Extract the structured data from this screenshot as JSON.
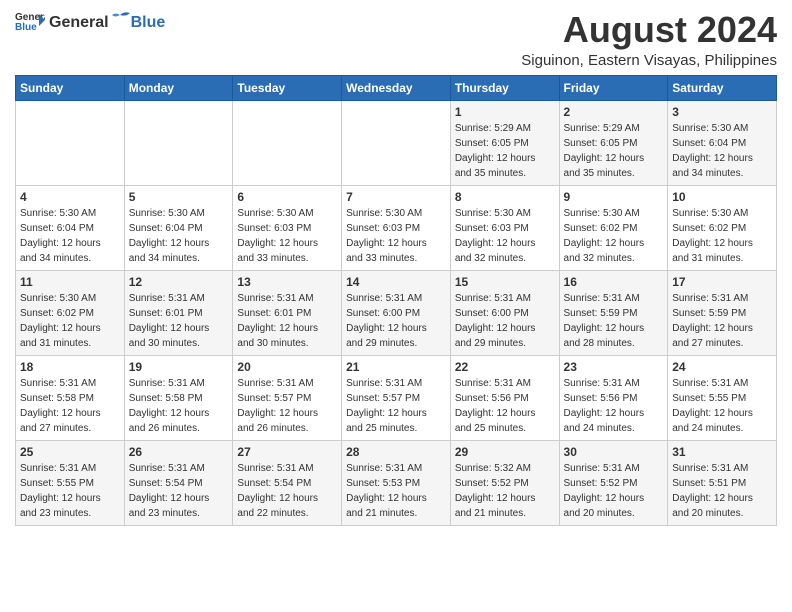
{
  "header": {
    "logo_general": "General",
    "logo_blue": "Blue",
    "month_year": "August 2024",
    "location": "Siguinon, Eastern Visayas, Philippines"
  },
  "days_of_week": [
    "Sunday",
    "Monday",
    "Tuesday",
    "Wednesday",
    "Thursday",
    "Friday",
    "Saturday"
  ],
  "weeks": [
    [
      {
        "day": "",
        "sunrise": "",
        "sunset": "",
        "daylight": ""
      },
      {
        "day": "",
        "sunrise": "",
        "sunset": "",
        "daylight": ""
      },
      {
        "day": "",
        "sunrise": "",
        "sunset": "",
        "daylight": ""
      },
      {
        "day": "",
        "sunrise": "",
        "sunset": "",
        "daylight": ""
      },
      {
        "day": "1",
        "sunrise": "5:29 AM",
        "sunset": "6:05 PM",
        "daylight": "12 hours and 35 minutes."
      },
      {
        "day": "2",
        "sunrise": "5:29 AM",
        "sunset": "6:05 PM",
        "daylight": "12 hours and 35 minutes."
      },
      {
        "day": "3",
        "sunrise": "5:30 AM",
        "sunset": "6:04 PM",
        "daylight": "12 hours and 34 minutes."
      }
    ],
    [
      {
        "day": "4",
        "sunrise": "5:30 AM",
        "sunset": "6:04 PM",
        "daylight": "12 hours and 34 minutes."
      },
      {
        "day": "5",
        "sunrise": "5:30 AM",
        "sunset": "6:04 PM",
        "daylight": "12 hours and 34 minutes."
      },
      {
        "day": "6",
        "sunrise": "5:30 AM",
        "sunset": "6:03 PM",
        "daylight": "12 hours and 33 minutes."
      },
      {
        "day": "7",
        "sunrise": "5:30 AM",
        "sunset": "6:03 PM",
        "daylight": "12 hours and 33 minutes."
      },
      {
        "day": "8",
        "sunrise": "5:30 AM",
        "sunset": "6:03 PM",
        "daylight": "12 hours and 32 minutes."
      },
      {
        "day": "9",
        "sunrise": "5:30 AM",
        "sunset": "6:02 PM",
        "daylight": "12 hours and 32 minutes."
      },
      {
        "day": "10",
        "sunrise": "5:30 AM",
        "sunset": "6:02 PM",
        "daylight": "12 hours and 31 minutes."
      }
    ],
    [
      {
        "day": "11",
        "sunrise": "5:30 AM",
        "sunset": "6:02 PM",
        "daylight": "12 hours and 31 minutes."
      },
      {
        "day": "12",
        "sunrise": "5:31 AM",
        "sunset": "6:01 PM",
        "daylight": "12 hours and 30 minutes."
      },
      {
        "day": "13",
        "sunrise": "5:31 AM",
        "sunset": "6:01 PM",
        "daylight": "12 hours and 30 minutes."
      },
      {
        "day": "14",
        "sunrise": "5:31 AM",
        "sunset": "6:00 PM",
        "daylight": "12 hours and 29 minutes."
      },
      {
        "day": "15",
        "sunrise": "5:31 AM",
        "sunset": "6:00 PM",
        "daylight": "12 hours and 29 minutes."
      },
      {
        "day": "16",
        "sunrise": "5:31 AM",
        "sunset": "5:59 PM",
        "daylight": "12 hours and 28 minutes."
      },
      {
        "day": "17",
        "sunrise": "5:31 AM",
        "sunset": "5:59 PM",
        "daylight": "12 hours and 27 minutes."
      }
    ],
    [
      {
        "day": "18",
        "sunrise": "5:31 AM",
        "sunset": "5:58 PM",
        "daylight": "12 hours and 27 minutes."
      },
      {
        "day": "19",
        "sunrise": "5:31 AM",
        "sunset": "5:58 PM",
        "daylight": "12 hours and 26 minutes."
      },
      {
        "day": "20",
        "sunrise": "5:31 AM",
        "sunset": "5:57 PM",
        "daylight": "12 hours and 26 minutes."
      },
      {
        "day": "21",
        "sunrise": "5:31 AM",
        "sunset": "5:57 PM",
        "daylight": "12 hours and 25 minutes."
      },
      {
        "day": "22",
        "sunrise": "5:31 AM",
        "sunset": "5:56 PM",
        "daylight": "12 hours and 25 minutes."
      },
      {
        "day": "23",
        "sunrise": "5:31 AM",
        "sunset": "5:56 PM",
        "daylight": "12 hours and 24 minutes."
      },
      {
        "day": "24",
        "sunrise": "5:31 AM",
        "sunset": "5:55 PM",
        "daylight": "12 hours and 24 minutes."
      }
    ],
    [
      {
        "day": "25",
        "sunrise": "5:31 AM",
        "sunset": "5:55 PM",
        "daylight": "12 hours and 23 minutes."
      },
      {
        "day": "26",
        "sunrise": "5:31 AM",
        "sunset": "5:54 PM",
        "daylight": "12 hours and 23 minutes."
      },
      {
        "day": "27",
        "sunrise": "5:31 AM",
        "sunset": "5:54 PM",
        "daylight": "12 hours and 22 minutes."
      },
      {
        "day": "28",
        "sunrise": "5:31 AM",
        "sunset": "5:53 PM",
        "daylight": "12 hours and 21 minutes."
      },
      {
        "day": "29",
        "sunrise": "5:32 AM",
        "sunset": "5:52 PM",
        "daylight": "12 hours and 21 minutes."
      },
      {
        "day": "30",
        "sunrise": "5:31 AM",
        "sunset": "5:52 PM",
        "daylight": "12 hours and 20 minutes."
      },
      {
        "day": "31",
        "sunrise": "5:31 AM",
        "sunset": "5:51 PM",
        "daylight": "12 hours and 20 minutes."
      }
    ]
  ],
  "labels": {
    "sunrise_label": "Sunrise:",
    "sunset_label": "Sunset:",
    "daylight_label": "Daylight:"
  }
}
